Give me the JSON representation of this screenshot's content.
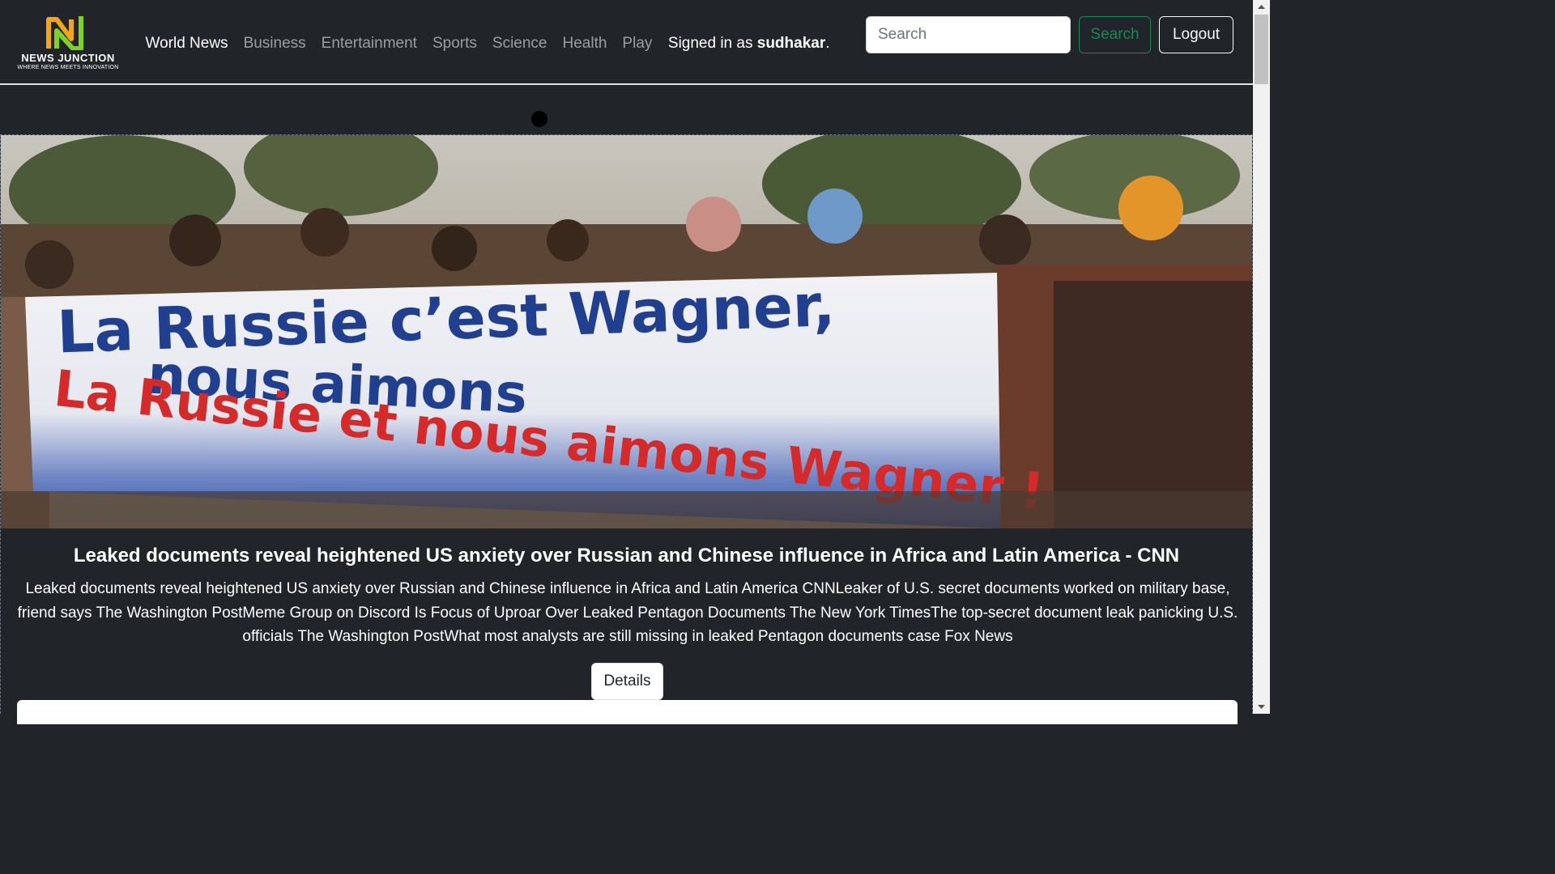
{
  "brand": {
    "name": "NEWS JUNCTION",
    "tagline": "WHERE NEWS MEETS INNOVATION"
  },
  "nav": {
    "items": [
      {
        "label": "World News",
        "active": true
      },
      {
        "label": "Business",
        "active": false
      },
      {
        "label": "Entertainment",
        "active": false
      },
      {
        "label": "Sports",
        "active": false
      },
      {
        "label": "Science",
        "active": false
      },
      {
        "label": "Health",
        "active": false
      },
      {
        "label": "Play",
        "active": false
      }
    ],
    "signed_in_prefix": "Signed in as ",
    "username": "sudhakar",
    "signed_in_suffix": "."
  },
  "search": {
    "placeholder": "Search",
    "button_label": "Search"
  },
  "logout_label": "Logout",
  "article": {
    "title": "Leaked documents reveal heightened US anxiety over Russian and Chinese influence in Africa and Latin America - CNN",
    "description": "Leaked documents reveal heightened US anxiety over Russian and Chinese influence in Africa and Latin America CNNLeaker of U.S. secret documents worked on military base, friend says The Washington PostMeme Group on Discord Is Focus of Uproar Over Leaked Pentagon Documents The New York TimesThe top-secret document leak panicking U.S. officials The Washington PostWhat most analysts are still missing in leaked Pentagon documents case Fox News",
    "details_label": "Details",
    "image": {
      "banner_line1": "La Russie c’est Wagner,",
      "banner_line2": "nous aimons",
      "banner_line3": "La Russie et nous aimons Wagner !"
    }
  },
  "colors": {
    "background": "#212529",
    "search_green": "#198754",
    "banner_blue": "#1d3a8a",
    "banner_red": "#d42a2a"
  }
}
